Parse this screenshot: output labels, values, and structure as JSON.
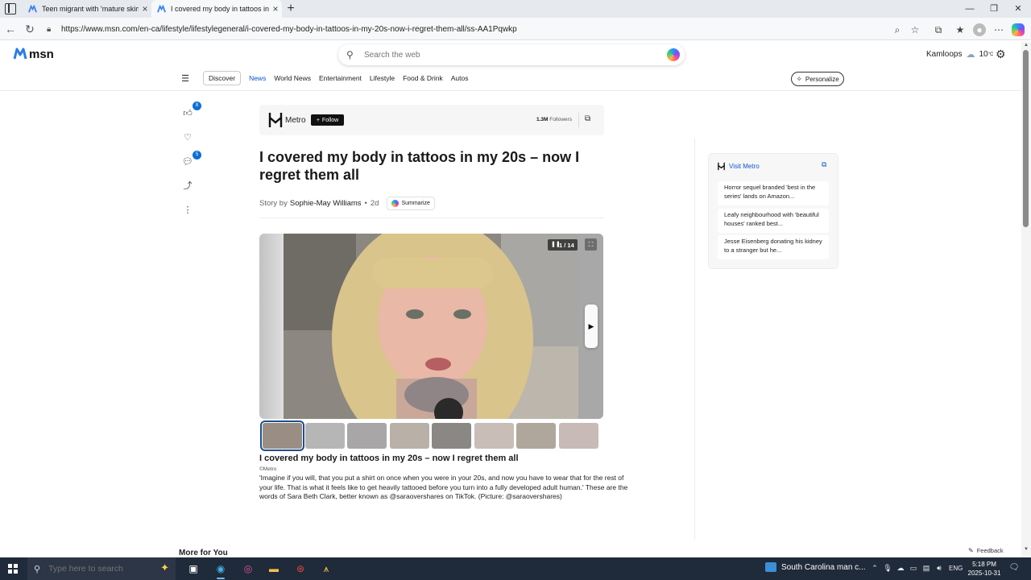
{
  "browser": {
    "tabs": [
      {
        "title": "Teen migrant with 'mature skin' w",
        "active": false
      },
      {
        "title": "I covered my body in tattoos in m",
        "active": true
      }
    ],
    "new_tab": "+",
    "url": "https://www.msn.com/en-ca/lifestyle/lifestylegeneral/i-covered-my-body-in-tattoos-in-my-20s-now-i-regret-them-all/ss-AA1Pqwkp",
    "window": {
      "minimize": "—",
      "maximize": "❐",
      "close": "✕"
    }
  },
  "msn": {
    "logo_text": "msn",
    "search_placeholder": "Search the web",
    "weather": {
      "city": "Kamloops",
      "temp": "10",
      "unit": "°C"
    },
    "nav": [
      "Discover",
      "News",
      "World News",
      "Entertainment",
      "Lifestyle",
      "Food & Drink",
      "Autos"
    ],
    "personalize": "Personalize"
  },
  "rail": {
    "likes": "8",
    "comments": "5"
  },
  "publisher": {
    "name": "Metro",
    "follow": "Follow",
    "followers_count": "1.3M",
    "followers_label": "Followers"
  },
  "article": {
    "headline": "I covered my body in tattoos in my 20s – now I regret them all",
    "story_by": "Story by",
    "author": "Sophie-May Williams",
    "age": "2d",
    "summarize": "Summarize"
  },
  "slideshow": {
    "counter": "1 / 14",
    "title": "I covered my body in tattoos in my 20s – now I regret them all",
    "credit": "©Metro",
    "caption": "'Imagine if you will, that you put a shirt on once when you were in your 20s, and now you have to wear that for the rest of your life. That is what it feels like to get heavily tattooed before you turn into a fully developed adult human.' These are the words of Sara Beth Clark, better known as @saraovershares on TikTok. (Picture: @saraovershares)",
    "thumb_colors": [
      "#9a8e84",
      "#b7b6b7",
      "#a8a6a6",
      "#b9b1a8",
      "#8a8784",
      "#c9bdb8",
      "#b0a79c",
      "#c8bab6"
    ]
  },
  "sidebar": {
    "visit_label": "Visit Metro",
    "items": [
      "Horror sequel branded 'best in the series' lands on Amazon...",
      "Leafy neighbourhood with 'beautiful houses' ranked best...",
      "Jesse Eisenberg donating his kidney to a stranger but he..."
    ]
  },
  "more_for_you": "More for You",
  "feedback": "Feedback",
  "taskbar": {
    "search_placeholder": "Type here to search",
    "news_text": "South Carolina man c...",
    "lang": "ENG",
    "time": "5:18 PM",
    "date": "2025-10-31"
  }
}
